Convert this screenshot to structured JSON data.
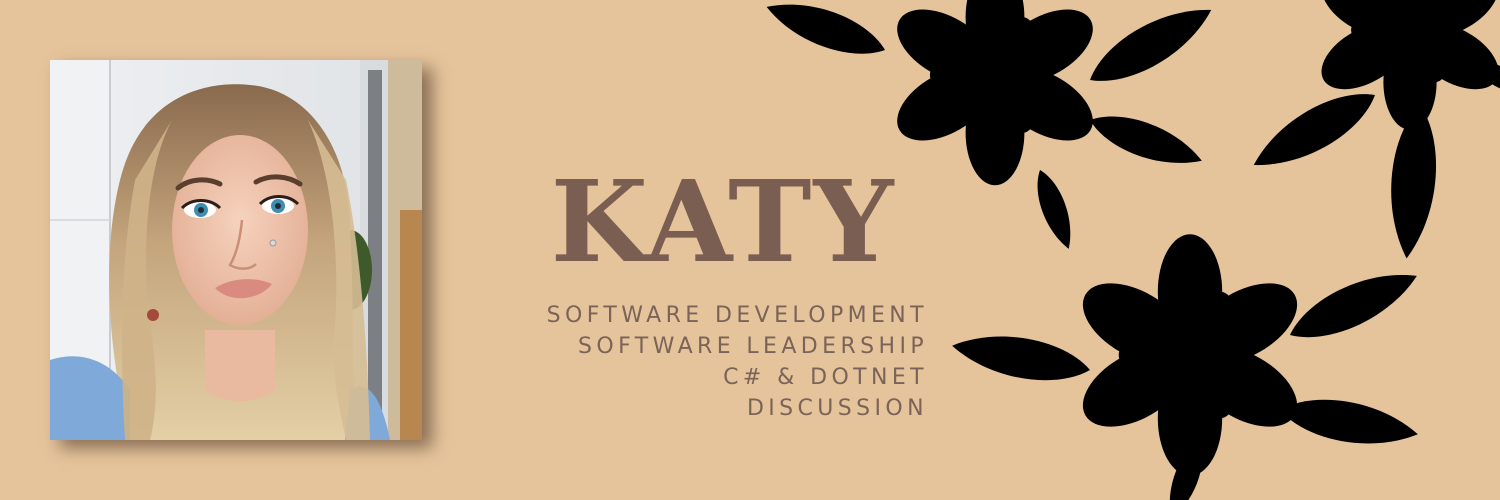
{
  "banner": {
    "name": "KATY",
    "tagline_lines": [
      "SOFTWARE DEVELOPMENT",
      "SOFTWARE LEADERSHIP",
      "C# & DOTNET",
      "DISCUSSION"
    ]
  },
  "colors": {
    "background": "#e6c49b",
    "name_text": "#7a5e52",
    "tagline_text": "#7a6358",
    "flower_outline": "#6b5348"
  },
  "icons": {
    "portrait": "portrait-photo",
    "flowers": "magnolia-line-art"
  }
}
